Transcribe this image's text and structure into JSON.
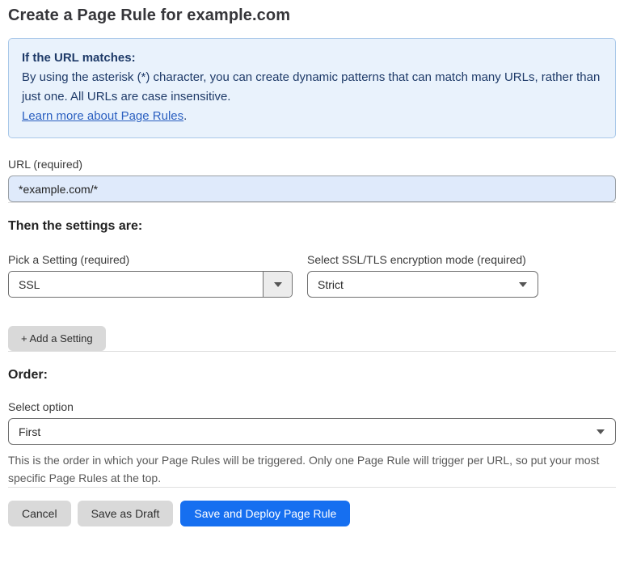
{
  "page": {
    "title": "Create a Page Rule for example.com"
  },
  "info_box": {
    "heading": "If the URL matches:",
    "body": "By using the asterisk (*) character, you can create dynamic patterns that can match many URLs, rather than just one. All URLs are case insensitive.",
    "link_label": "Learn more about Page Rules",
    "link_suffix": "."
  },
  "url_field": {
    "label": "URL (required)",
    "value": "*example.com/*"
  },
  "settings_section": {
    "heading": "Then the settings are:",
    "setting_select": {
      "label": "Pick a Setting (required)",
      "value": "SSL"
    },
    "mode_select": {
      "label": "Select SSL/TLS encryption mode (required)",
      "value": "Strict"
    },
    "add_setting_label": "+ Add a Setting"
  },
  "order_section": {
    "heading": "Order:",
    "select_label": "Select option",
    "value": "First",
    "help_text": "This is the order in which your Page Rules will be triggered. Only one Page Rule will trigger per URL, so put your most specific Page Rules at the top."
  },
  "footer": {
    "cancel_label": "Cancel",
    "save_draft_label": "Save as Draft",
    "save_deploy_label": "Save and Deploy Page Rule"
  },
  "colors": {
    "accent_blue": "#166ff0",
    "info_background": "#e9f2fc",
    "info_border": "#a9c8e9",
    "info_text": "#1e3a68",
    "link_blue": "#2a5fc0",
    "url_input_background": "#dfeafb"
  }
}
